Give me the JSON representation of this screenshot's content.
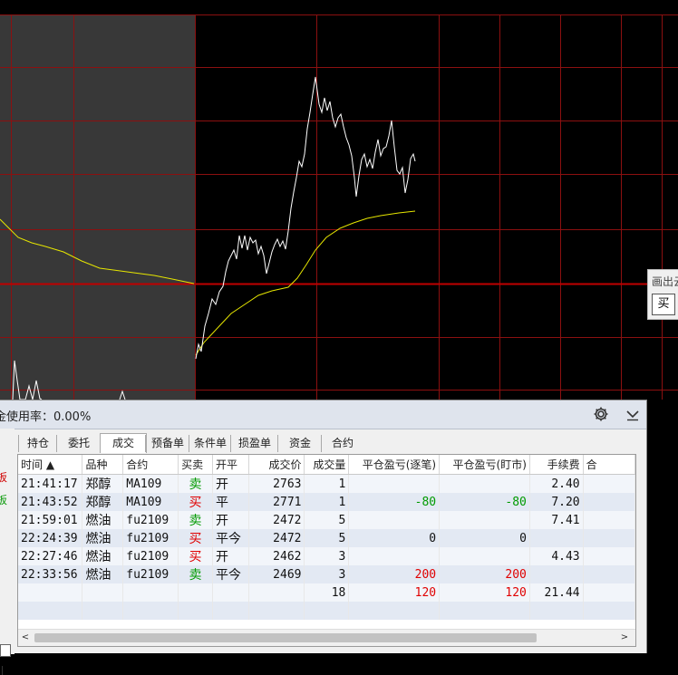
{
  "chart": {
    "background": "#000000",
    "shade_color": "#383838",
    "grid_color": "#8c1010",
    "mid_line_color": "#c00000",
    "price_color": "#ffffff",
    "avg_color": "#e6e600"
  },
  "float_widget": {
    "title": "画出云",
    "button": "买"
  },
  "panel": {
    "usage_label": "金使用率：0.00%",
    "settings_icon": "gear-icon",
    "collapse_icon": "chevron-down-icon",
    "side_red": "板",
    "side_green": "板",
    "tabs": [
      "持仓",
      "委托",
      "成交",
      "预备单",
      "条件单",
      "损盈单",
      "资金",
      "合约"
    ],
    "active_tab": 2,
    "columns": [
      "时间 ▲",
      "品种",
      "合约",
      "买卖",
      "开平",
      "成交价",
      "成交量",
      "平仓盈亏(逐笔)",
      "平仓盈亏(盯市)",
      "手续费",
      "合"
    ],
    "rows": [
      {
        "time": "21:41:17",
        "product": "郑醇",
        "contract": "MA109",
        "side": "卖",
        "side_color": "green",
        "oc": "开",
        "price": "2763",
        "qty": "1",
        "pnl_trade": "",
        "pnl_trade_color": "",
        "pnl_mtm": "",
        "pnl_mtm_color": "",
        "fee": "2.40"
      },
      {
        "time": "21:43:52",
        "product": "郑醇",
        "contract": "MA109",
        "side": "买",
        "side_color": "red",
        "oc": "平",
        "price": "2771",
        "qty": "1",
        "pnl_trade": "-80",
        "pnl_trade_color": "green",
        "pnl_mtm": "-80",
        "pnl_mtm_color": "green",
        "fee": "7.20"
      },
      {
        "time": "21:59:01",
        "product": "燃油",
        "contract": "fu2109",
        "side": "卖",
        "side_color": "green",
        "oc": "开",
        "price": "2472",
        "qty": "5",
        "pnl_trade": "",
        "pnl_trade_color": "",
        "pnl_mtm": "",
        "pnl_mtm_color": "",
        "fee": "7.41"
      },
      {
        "time": "22:24:39",
        "product": "燃油",
        "contract": "fu2109",
        "side": "买",
        "side_color": "red",
        "oc": "平今",
        "price": "2472",
        "qty": "5",
        "pnl_trade": "0",
        "pnl_trade_color": "",
        "pnl_mtm": "0",
        "pnl_mtm_color": "",
        "fee": ""
      },
      {
        "time": "22:27:46",
        "product": "燃油",
        "contract": "fu2109",
        "side": "买",
        "side_color": "red",
        "oc": "开",
        "price": "2462",
        "qty": "3",
        "pnl_trade": "",
        "pnl_trade_color": "",
        "pnl_mtm": "",
        "pnl_mtm_color": "",
        "fee": "4.43"
      },
      {
        "time": "22:33:56",
        "product": "燃油",
        "contract": "fu2109",
        "side": "卖",
        "side_color": "green",
        "oc": "平今",
        "price": "2469",
        "qty": "3",
        "pnl_trade": "200",
        "pnl_trade_color": "red",
        "pnl_mtm": "200",
        "pnl_mtm_color": "red",
        "fee": ""
      }
    ],
    "totals": {
      "qty": "18",
      "pnl_trade": "120",
      "pnl_mtm": "120",
      "fee": "21.44"
    },
    "scroll_left": "<",
    "scroll_right": ">"
  }
}
